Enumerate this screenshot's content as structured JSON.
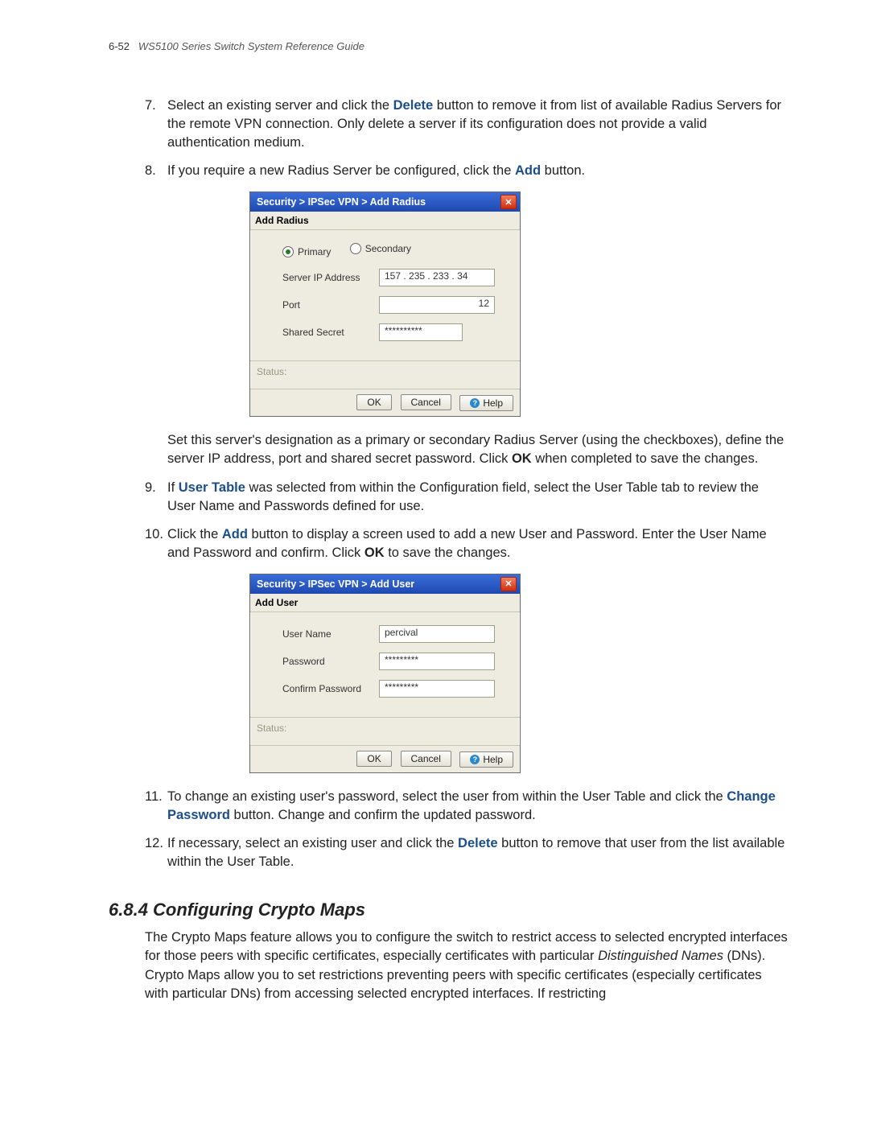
{
  "header": {
    "page_number": "6-52",
    "guide_title": "WS5100 Series Switch System Reference Guide"
  },
  "steps": {
    "s7": {
      "num": "7.",
      "pre": "Select an existing server and click the ",
      "kw": "Delete",
      "post": " button to remove it from list of available Radius Servers for the remote VPN connection. Only delete a server if its configuration does not provide a valid authentication medium."
    },
    "s8": {
      "num": "8.",
      "pre": "If you require a new Radius Server be configured, click the ",
      "kw": "Add",
      "post": " button."
    },
    "s8b": {
      "pre": "Set this server's designation as a primary or secondary Radius Server (using the checkboxes), define the server IP address, port and shared secret password. Click ",
      "kw": "OK",
      "post": " when completed to save the changes."
    },
    "s9": {
      "num": "9.",
      "pre": "If ",
      "kw": "User Table",
      "post": " was selected from within the Configuration field, select the User Table tab to review the User Name and Passwords defined for use."
    },
    "s10": {
      "num": "10.",
      "pre": "Click the ",
      "kw": "Add",
      "mid": " button to display a screen used to add a new User and Password. Enter the User Name and Password and confirm. Click ",
      "kw2": "OK",
      "post": " to save the changes."
    },
    "s11": {
      "num": "11.",
      "pre": "To change an existing user's password, select the user from within the User Table and click the ",
      "kw": "Change Password",
      "post": " button. Change and confirm the updated password."
    },
    "s12": {
      "num": "12.",
      "pre": "If necessary, select an existing user and click the ",
      "kw": "Delete",
      "post": " button to remove that user from the list available within the User Table."
    }
  },
  "dialog1": {
    "title": "Security > IPSec VPN > Add Radius",
    "subtitle": "Add Radius",
    "radio_primary": "Primary",
    "radio_secondary": "Secondary",
    "ip_label": "Server IP Address",
    "ip_value": "157 . 235 . 233 .  34",
    "port_label": "Port",
    "port_value": "12",
    "secret_label": "Shared Secret",
    "secret_value": "**********",
    "status_label": "Status:",
    "ok": "OK",
    "cancel": "Cancel",
    "help": "Help"
  },
  "dialog2": {
    "title": "Security > IPSec VPN > Add User",
    "subtitle": "Add User",
    "user_label": "User Name",
    "user_value": "percival",
    "pwd_label": "Password",
    "pwd_value": "*********",
    "cpwd_label": "Confirm Password",
    "cpwd_value": "*********",
    "status_label": "Status:",
    "ok": "OK",
    "cancel": "Cancel",
    "help": "Help"
  },
  "section": {
    "heading": "6.8.4 Configuring Crypto Maps",
    "body_pre": "The Crypto Maps feature allows you to configure the switch to restrict access to selected encrypted interfaces for those peers with specific certificates, especially certificates with particular ",
    "body_em": "Distinguished Names",
    "body_post": " (DNs). Crypto Maps allow you to set restrictions preventing peers with specific certificates (especially certificates with particular DNs) from accessing selected encrypted interfaces. If restricting"
  }
}
